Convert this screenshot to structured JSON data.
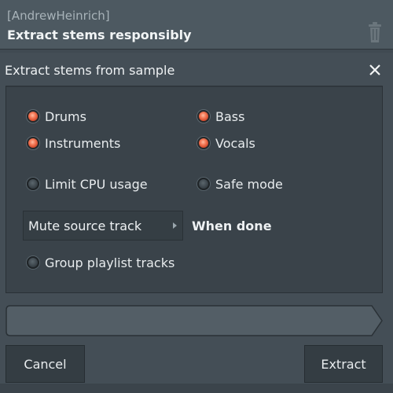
{
  "hint": {
    "user": "[AndrewHeinrich]",
    "message": "Extract stems responsibly",
    "icon": "trash-can-icon"
  },
  "dialog": {
    "title": "Extract stems from sample",
    "close_icon": "close-icon"
  },
  "options": {
    "drums": {
      "label": "Drums",
      "checked": true
    },
    "bass": {
      "label": "Bass",
      "checked": true
    },
    "instruments": {
      "label": "Instruments",
      "checked": true
    },
    "vocals": {
      "label": "Vocals",
      "checked": true
    },
    "limit_cpu": {
      "label": "Limit CPU usage",
      "checked": false
    },
    "safe_mode": {
      "label": "Safe mode",
      "checked": false
    },
    "group_playlist": {
      "label": "Group playlist tracks",
      "checked": false
    }
  },
  "after": {
    "selected": "Mute source track",
    "suffix": "When done"
  },
  "buttons": {
    "cancel": "Cancel",
    "extract": "Extract"
  },
  "colors": {
    "accent": "#f47a58",
    "background": "#444e56"
  }
}
